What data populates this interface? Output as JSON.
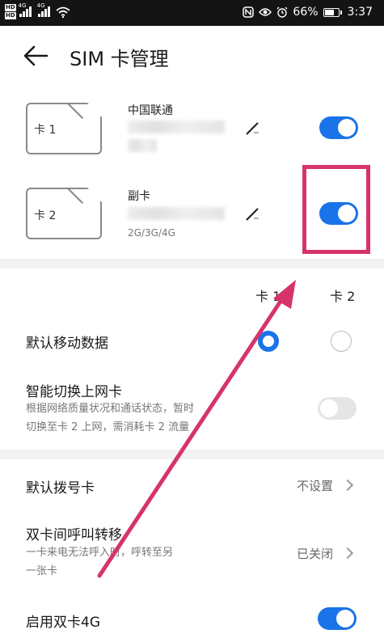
{
  "status_bar": {
    "hd_labels": [
      "HD",
      "HD"
    ],
    "network_1": "4G",
    "network_2": "4G",
    "battery": "66%",
    "battery_level": 0.66,
    "time": "3:37"
  },
  "header": {
    "title": "SIM 卡管理"
  },
  "cards": [
    {
      "slot_label": "卡 1",
      "name": "中国联通",
      "network": "",
      "enabled": true
    },
    {
      "slot_label": "卡 2",
      "name": "副卡",
      "network": "2G/3G/4G",
      "enabled": true
    }
  ],
  "columns": {
    "card1": "卡 1",
    "card2": "卡 2"
  },
  "settings": {
    "default_data": {
      "label": "默认移动数据",
      "selected": "card1"
    },
    "smart_switch": {
      "label": "智能切换上网卡",
      "desc_line1": "根据网络质量状况和通话状态，暂时",
      "desc_line2": "切换至卡 2 上网，需消耗卡 2 流量",
      "enabled": false
    },
    "default_dial": {
      "label": "默认拨号卡",
      "value": "不设置"
    },
    "call_forward": {
      "label": "双卡间呼叫转移",
      "desc_line1": "一卡来电无法呼入时，呼转至另",
      "desc_line2": "一张卡",
      "value": "已关闭"
    },
    "dual_4g": {
      "label": "启用双卡4G",
      "enabled": true
    }
  },
  "colors": {
    "accent": "#1a73e8",
    "annotation": "#d6336c"
  }
}
